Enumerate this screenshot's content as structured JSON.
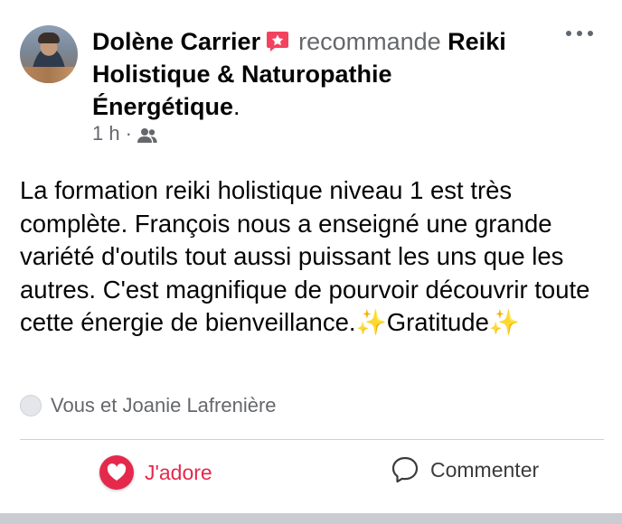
{
  "post": {
    "author": "Dolène Carrier",
    "verb": "recommande",
    "page_name": "Reiki Holistique & Naturopathie Énergétique",
    "punct": ".",
    "time": "1 h",
    "sep": "·",
    "audience_icon": "friends-icon",
    "more_icon": "more-options-icon",
    "badge_icon": "recommendation-icon",
    "text": "La formation reiki holistique niveau 1 est très complète. François nous a enseigné une grande variété d'outils tout aussi puissant les uns que les autres. C'est magnifique de pourvoir découvrir toute cette énergie de bienveillance.✨Gratitude✨"
  },
  "reactions": {
    "summary": "Vous et Joanie Lafrenière"
  },
  "actions": {
    "love_label": "J'adore",
    "comment_label": "Commenter"
  },
  "colors": {
    "love": "#e4294c",
    "muted": "#65676b",
    "badge": "#f3425f"
  }
}
